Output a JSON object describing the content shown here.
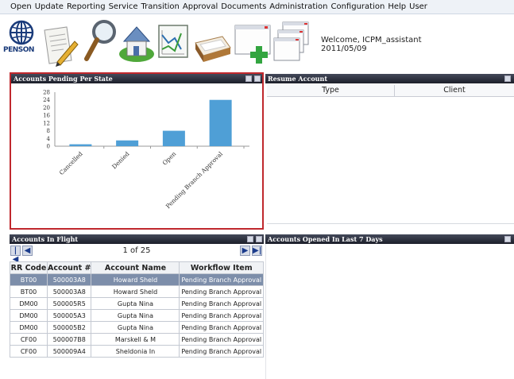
{
  "menu": [
    "Open",
    "Update",
    "Reporting",
    "Service",
    "Transition",
    "Approval",
    "Documents",
    "Administration",
    "Configuration",
    "Help",
    "User"
  ],
  "toolbar": {
    "logo_text": "PENSON",
    "icons": [
      "penson-logo-icon",
      "document-edit-icon",
      "search-magnifier-icon",
      "house-icon",
      "line-chart-icon",
      "inbox-tray-icon",
      "new-window-icon",
      "windows-cascade-icon"
    ],
    "welcome_line1": "Welcome, ICPM_assistant",
    "welcome_line2": "2011/05/09"
  },
  "pending_panel": {
    "title": "Accounts Pending Per State"
  },
  "chart_data": {
    "type": "bar",
    "categories": [
      "Cancelled",
      "Denied",
      "Open",
      "Pending Branch Approval"
    ],
    "values": [
      1,
      3,
      8,
      24
    ],
    "yticks": [
      0,
      4,
      8,
      12,
      16,
      20,
      24,
      28
    ],
    "ylim": [
      0,
      28
    ],
    "bar_color": "#4f9fd6"
  },
  "resume_panel": {
    "title": "Resume Account",
    "columns": [
      "Type",
      "Client"
    ]
  },
  "inflight_panel": {
    "title": "Accounts In Flight",
    "pager": "1 of 25",
    "columns": [
      "RR Code",
      "Account #",
      "Account Name",
      "Workflow Item"
    ],
    "rows": [
      [
        "BT00",
        "500003A8",
        "Howard Sheld",
        "Pending Branch Approval"
      ],
      [
        "BT00",
        "500003A8",
        "Howard Sheld",
        "Pending Branch Approval"
      ],
      [
        "DM00",
        "500005R5",
        "Gupta Nina",
        "Pending Branch Approval"
      ],
      [
        "DM00",
        "500005A3",
        "Gupta Nina",
        "Pending Branch Approval"
      ],
      [
        "DM00",
        "500005B2",
        "Gupta Nina",
        "Pending Branch Approval"
      ],
      [
        "CF00",
        "500007B8",
        "Marskell & M",
        "Pending Branch Approval"
      ],
      [
        "CF00",
        "500009A4",
        "Sheldonia In",
        "Pending Branch Approval"
      ]
    ],
    "selected_row": 0
  },
  "opened_panel": {
    "title": "Accounts Opened In Last 7 Days"
  },
  "colors": {
    "title_bar": "#2b2f3c",
    "selection": "#7d8eaa",
    "highlight_border": "#c0282d"
  }
}
